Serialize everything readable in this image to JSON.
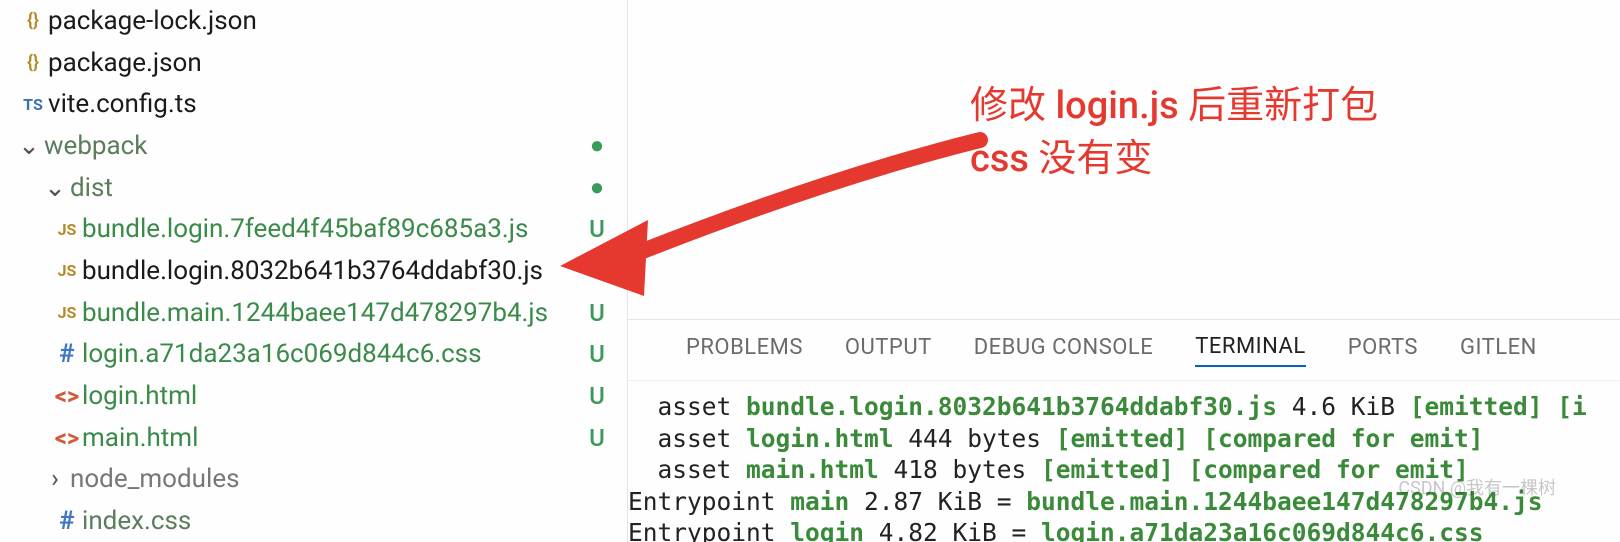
{
  "sidebar": {
    "items": [
      {
        "icon": "{}",
        "iconcls": "json",
        "indent": "indent-0",
        "label": "package-lock.json",
        "status": "",
        "row": ""
      },
      {
        "icon": "{}",
        "iconcls": "json",
        "indent": "indent-0",
        "label": "package.json",
        "status": "",
        "row": ""
      },
      {
        "icon": "TS",
        "iconcls": "ts",
        "indent": "indent-0",
        "label": "vite.config.ts",
        "status": "",
        "row": ""
      },
      {
        "chev": "⌄",
        "icon": "",
        "iconcls": "",
        "indent": "indent-1 dim",
        "label": "webpack",
        "status": "●",
        "statuscls": "dot",
        "row": ""
      },
      {
        "chev": "⌄",
        "icon": "",
        "iconcls": "",
        "indent": "indent-2 dim",
        "label": "dist",
        "status": "●",
        "statuscls": "dot",
        "row": ""
      },
      {
        "icon": "JS",
        "iconcls": "js",
        "indent": "indent-3 untracked",
        "label": "bundle.login.7feed4f45baf89c685a3.js",
        "status": "U",
        "statuscls": "u"
      },
      {
        "icon": "JS",
        "iconcls": "js",
        "indent": "indent-3",
        "label": "bundle.login.8032b641b3764ddabf30.js",
        "status": "",
        "row": ""
      },
      {
        "icon": "JS",
        "iconcls": "js",
        "indent": "indent-3 untracked",
        "label": "bundle.main.1244baee147d478297b4.js",
        "status": "U",
        "statuscls": "u"
      },
      {
        "icon": "#",
        "iconcls": "hash",
        "indent": "indent-3 untracked",
        "label": "login.a71da23a16c069d844c6.css",
        "status": "U",
        "statuscls": "u"
      },
      {
        "icon": "<>",
        "iconcls": "html",
        "indent": "indent-3 untracked",
        "label": "login.html",
        "status": "U",
        "statuscls": "u"
      },
      {
        "icon": "<>",
        "iconcls": "html",
        "indent": "indent-3 untracked",
        "label": "main.html",
        "status": "U",
        "statuscls": "u"
      },
      {
        "chev": "›",
        "icon": "",
        "iconcls": "",
        "indent": "indent-2 dim2",
        "label": "node_modules",
        "status": "",
        "row": ""
      },
      {
        "icon": "#",
        "iconcls": "hash",
        "indent": "indent-3 dim",
        "label": "index.css",
        "status": "",
        "row": ""
      }
    ]
  },
  "annotation": {
    "line1": "修改 login.js 后重新打包",
    "line2": "css 没有变"
  },
  "panel_tabs": [
    "PROBLEMS",
    "OUTPUT",
    "DEBUG CONSOLE",
    "TERMINAL",
    "PORTS",
    "GITLEN"
  ],
  "active_tab_index": 3,
  "terminal": {
    "lines": [
      {
        "prefix": "  asset ",
        "name": "bundle.login.8032b641b3764ddabf30.js",
        "rest": " 4.6 KiB ",
        "tags": "[emitted] [i"
      },
      {
        "prefix": "  asset ",
        "name": "login.html",
        "rest": " 444 bytes ",
        "tags": "[emitted] [compared for emit]"
      },
      {
        "prefix": "  asset ",
        "name": "main.html",
        "rest": " 418 bytes ",
        "tags": "[emitted] [compared for emit]"
      },
      {
        "entry": true,
        "prefix": "Entrypoint ",
        "ep": "main",
        "mid": " 2.87 KiB = ",
        "file": "bundle.main.1244baee147d478297b4.js"
      },
      {
        "entry": true,
        "prefix": "Entrypoint ",
        "ep": "login",
        "mid": " 4.82 KiB = ",
        "file": "login.a71da23a16c069d844c6.css"
      }
    ]
  },
  "watermark": "CSDN @我有一棵树"
}
